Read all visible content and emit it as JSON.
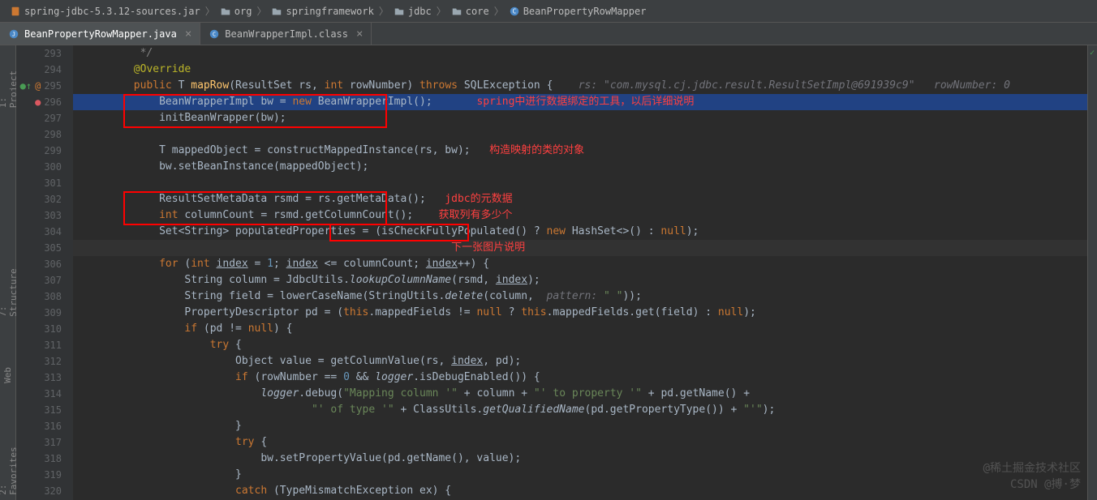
{
  "breadcrumb": [
    {
      "label": "spring-jdbc-5.3.12-sources.jar",
      "icon": "jar"
    },
    {
      "label": "org",
      "icon": "folder"
    },
    {
      "label": "springframework",
      "icon": "folder"
    },
    {
      "label": "jdbc",
      "icon": "folder"
    },
    {
      "label": "core",
      "icon": "folder"
    },
    {
      "label": "BeanPropertyRowMapper",
      "icon": "class"
    }
  ],
  "tabs": [
    {
      "label": "BeanPropertyRowMapper.java",
      "icon": "java",
      "active": true
    },
    {
      "label": "BeanWrapperImpl.class",
      "icon": "class",
      "active": false
    }
  ],
  "sidebar": {
    "items": [
      "1: Project",
      "7: Structure",
      "Web",
      "2: Favorites"
    ]
  },
  "lines": {
    "start": 293,
    "end": 320
  },
  "code": {
    "l293": "        */",
    "l294": "       @Override",
    "l295": "       public T mapRow(ResultSet rs, int rowNumber) throws SQLException {    rs: \"com.mysql.cj.jdbc.result.ResultSetImpl@691939c9\"   rowNumber: 0",
    "l296": "           BeanWrapperImpl bw = new BeanWrapperImpl();       spring中进行数据绑定的工具，以后详细说明",
    "l297": "           initBeanWrapper(bw);",
    "l298": "",
    "l299": "           T mappedObject = constructMappedInstance(rs, bw);   构造映射的类的对象",
    "l300": "           bw.setBeanInstance(mappedObject);",
    "l301": "",
    "l302": "           ResultSetMetaData rsmd = rs.getMetaData();   jdbc的元数据",
    "l303": "           int columnCount = rsmd.getColumnCount();    获取列有多少个",
    "l304": "           Set<String> populatedProperties = (isCheckFullyPopulated() ? new HashSet<>() : null);",
    "l305": "                                                         下一张图片说明",
    "l306": "           for (int index = 1; index <= columnCount; index++) {",
    "l307": "               String column = JdbcUtils.lookupColumnName(rsmd, index);",
    "l308": "               String field = lowerCaseName(StringUtils.delete(column,  pattern: \" \"));",
    "l309": "               PropertyDescriptor pd = (this.mappedFields != null ? this.mappedFields.get(field) : null);",
    "l310": "               if (pd != null) {",
    "l311": "                   try {",
    "l312": "                       Object value = getColumnValue(rs, index, pd);",
    "l313": "                       if (rowNumber == 0 && logger.isDebugEnabled()) {",
    "l314": "                           logger.debug(\"Mapping column '\" + column + \"' to property '\" + pd.getName() +",
    "l315": "                                   \"' of type '\" + ClassUtils.getQualifiedName(pd.getPropertyType()) + \"'\");",
    "l316": "                       }",
    "l317": "                       try {",
    "l318": "                           bw.setPropertyValue(pd.getName(), value);",
    "l319": "                       }",
    "l320": "                       catch (TypeMismatchException ex) {"
  },
  "annotations": {
    "red1": "spring中进行数据绑定的工具，以后详细说明",
    "red2": "构造映射的类的对象",
    "red3": "jdbc的元数据",
    "red4": "获取列有多少个",
    "red5": "下一张图片说明"
  },
  "watermark": {
    "line1": "@稀土掘金技术社区",
    "line2": "CSDN @搏·梦"
  }
}
